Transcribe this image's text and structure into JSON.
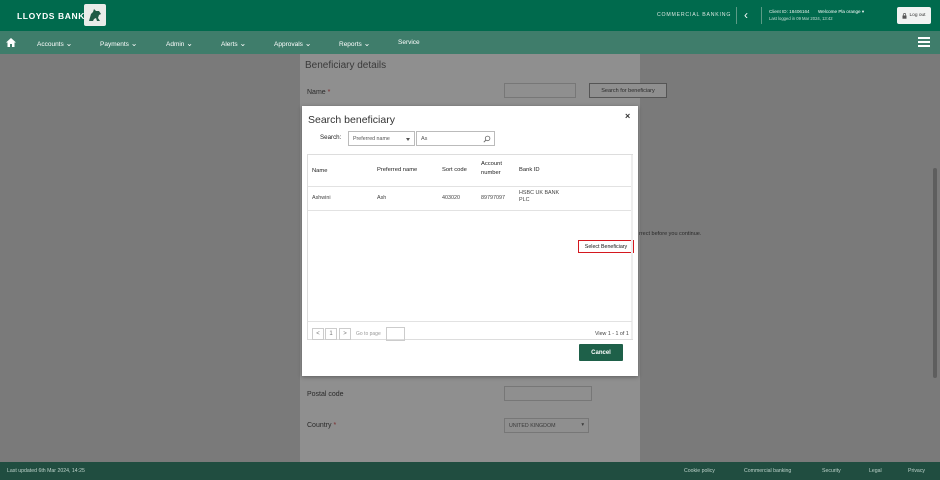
{
  "header": {
    "brand": "LLOYDS BANK",
    "product": "COMMERCIAL BANKING",
    "client_id": "Client ID: 18406164",
    "welcome": "Welcome Pla orange",
    "last_logged": "Last logged in 09 Mar 2024, 13:42",
    "logout_label": "Log out"
  },
  "nav": {
    "items": [
      "Accounts",
      "Payments",
      "Admin",
      "Alerts",
      "Approvals",
      "Reports",
      "Service"
    ]
  },
  "page": {
    "section_title": "Beneficiary details",
    "name_label": "Name",
    "required_mark": "*",
    "search_button": "Search for beneficiary",
    "notice_fragment": "rrect before you continue.",
    "postal_label": "Postal code",
    "country_label": "Country",
    "country_value": "UNITED KINGDOM"
  },
  "modal": {
    "title": "Search beneficiary",
    "close_symbol": "×",
    "search_label": "Search:",
    "search_by": "Preferred name",
    "search_value": "As",
    "columns": [
      "Name",
      "Preferred name",
      "Sort code",
      "Account number",
      "Bank ID"
    ],
    "rows": [
      {
        "name": "Ashwini",
        "preferred_name": "Ash",
        "sort_code": "403020",
        "account_number": "89797097",
        "bank_id": "HSBC UK BANK PLC",
        "action": "Select Beneficiary"
      }
    ],
    "pager": {
      "prev": "<",
      "page": "1",
      "next": ">",
      "goto_placeholder": "Go to page",
      "view_text": "View 1 - 1 of 1"
    },
    "cancel_label": "Cancel"
  },
  "footer": {
    "last_updated": "Last updated 6th Mar 2024, 14:25",
    "links": [
      "Cookie policy",
      "Commercial banking",
      "Security",
      "Legal",
      "Privacy"
    ]
  },
  "colors": {
    "brand_green": "#006a4d",
    "nav_green": "#3f7d6b",
    "footer_green": "#204d40",
    "highlight_red": "#d4181f"
  }
}
